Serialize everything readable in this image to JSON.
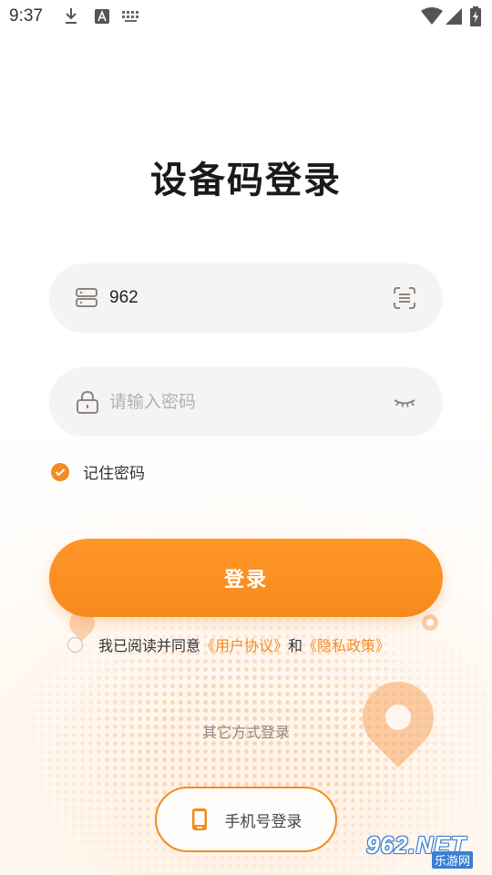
{
  "status_bar": {
    "time": "9:37",
    "icons": [
      "download-icon",
      "text-a-icon",
      "keyboard-icon",
      "wifi-icon",
      "cell-signal-icon",
      "battery-charging-icon"
    ]
  },
  "page": {
    "title": "设备码登录"
  },
  "device_field": {
    "icon": "device-icon",
    "value": "962",
    "trailing_icon": "scan-icon"
  },
  "password_field": {
    "icon": "lock-icon",
    "placeholder": "请输入密码",
    "trailing_icon": "eye-closed-icon"
  },
  "remember": {
    "label": "记住密码",
    "checked": true
  },
  "login_button": {
    "label": "登录"
  },
  "agreement": {
    "prefix": "我已阅读并同意",
    "user_agreement": "《用户协议》",
    "connector": "和",
    "privacy_policy": "《隐私政策》",
    "checked": false
  },
  "other_login": {
    "label": "其它方式登录"
  },
  "phone_login": {
    "label": "手机号登录",
    "icon": "phone-icon"
  },
  "watermark": {
    "main": "962.NET",
    "sub": "乐游网"
  },
  "colors": {
    "accent": "#f28b22",
    "button": "#f8891c",
    "field_bg": "#f6f4f2",
    "text": "#1a1a1a",
    "muted": "#8e8a86"
  }
}
